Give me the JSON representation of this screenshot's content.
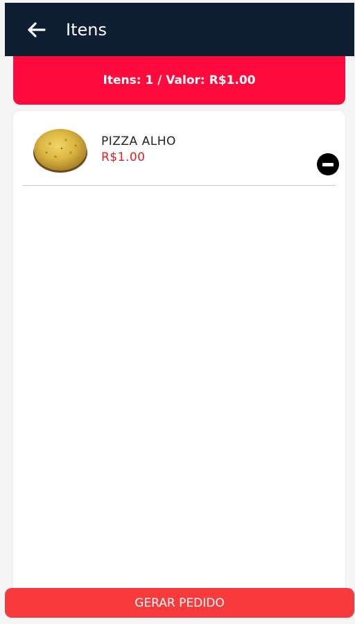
{
  "appbar": {
    "title": "Itens",
    "back_icon": "arrow-left-icon",
    "background_color": "#0e1f33"
  },
  "summary": {
    "text": "Itens: 1 / Valor: R$1.00",
    "background_color": "#ff0a3c"
  },
  "cart": {
    "items": [
      {
        "name": "PIZZA ALHO",
        "price": "R$1.00",
        "image": "garlic-pizza-photo",
        "action_icon": "minus-circle-icon"
      }
    ]
  },
  "footer": {
    "button_label": "GERAR PEDIDO",
    "background_color": "#f73b3c"
  },
  "colors": {
    "price": "#e31b23"
  }
}
